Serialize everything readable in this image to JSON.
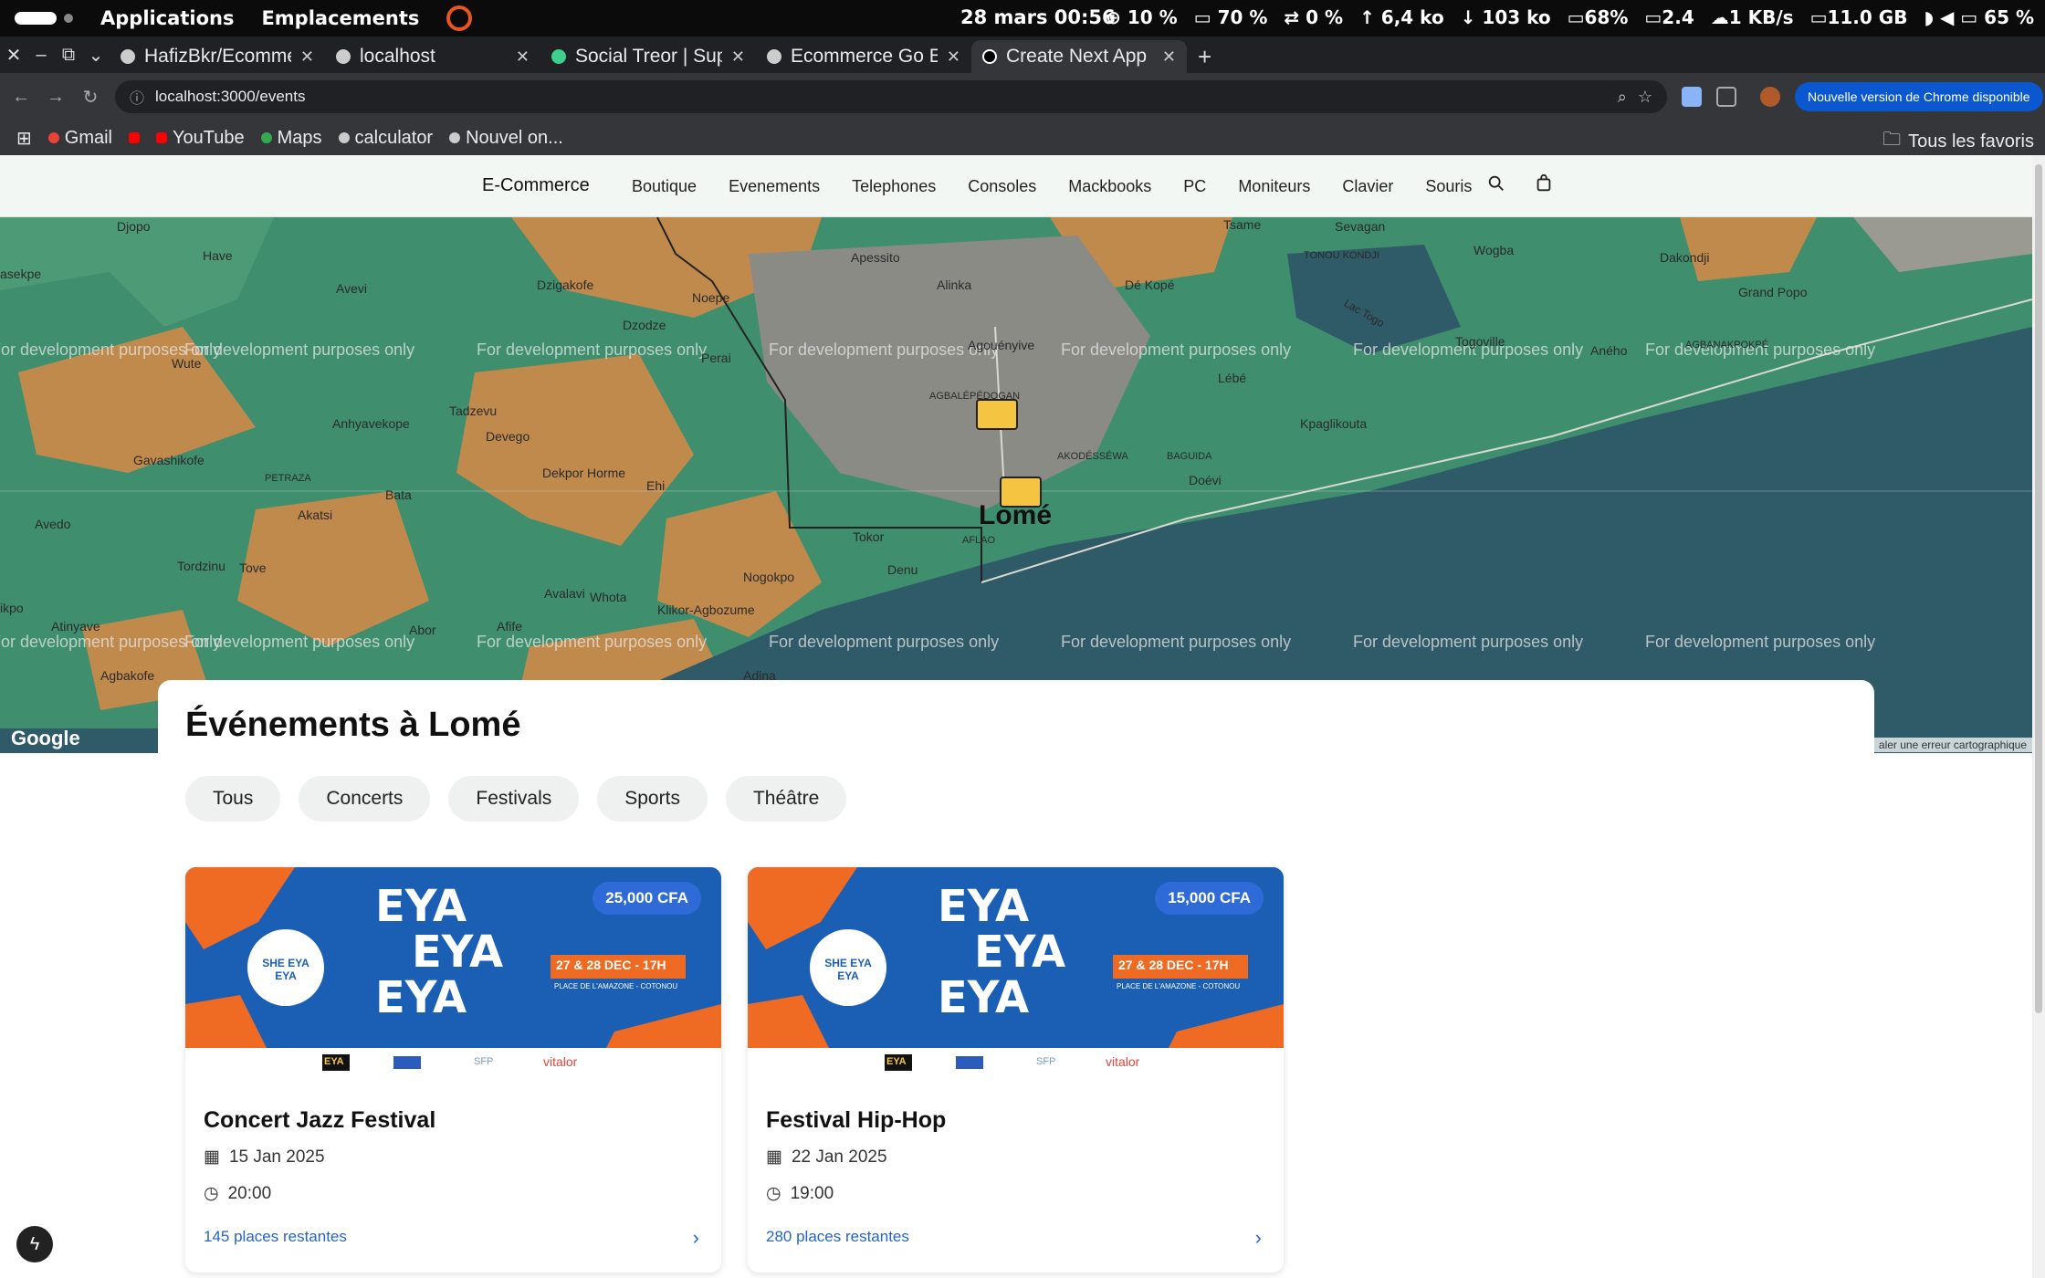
{
  "system": {
    "menu_applications": "Applications",
    "menu_places": "Emplacements",
    "clock": "28 mars  00:56",
    "indicators": [
      "⊕ 10 %",
      "▭ 70 %",
      "⇄ 0 %",
      "↑ 6,4 ko",
      "↓ 103 ko",
      "▭68%",
      "▭2.4",
      "☁1 KB/s",
      "▭11.0 GB",
      "◗ ◀ ▭ 65 %"
    ]
  },
  "browser": {
    "tabs": [
      {
        "title": "HafizBkr/Ecommerce",
        "active": false
      },
      {
        "title": "localhost",
        "active": false
      },
      {
        "title": "Social Treor | Sup",
        "active": false
      },
      {
        "title": "Ecommerce Go E",
        "active": false
      },
      {
        "title": "Create Next App",
        "active": true
      }
    ],
    "url": "localhost:3000/events",
    "update_label": "Nouvelle version de Chrome disponible",
    "bookmarks": [
      "Gmail",
      "YouTube",
      "Maps",
      "calculator",
      "Nouvel on..."
    ],
    "all_bookmarks": "Tous les favoris"
  },
  "site": {
    "brand": "E-Commerce",
    "nav": [
      "Boutique",
      "Evenements",
      "Telephones",
      "Consoles",
      "Mackbooks",
      "PC",
      "Moniteurs",
      "Clavier",
      "Souris"
    ]
  },
  "map": {
    "watermark": "For development purposes only",
    "city": "Lomé",
    "attribution": "Google",
    "error_link": "aler une erreur cartographique",
    "labels": [
      "Djopo",
      "Have",
      "Avevi",
      "Dzigakofe",
      "Dzodze",
      "Apessito",
      "Alinka",
      "Dé Kopé",
      "Tsame",
      "Sevagan",
      "Wogba",
      "Dakondji",
      "TONOU KONDJI",
      "Noepe",
      "Agouényive",
      "Wute",
      "Tadzevu",
      "Anhyavekope",
      "Devego",
      "AGBALÉPÉDOGAN",
      "AKODÉSSÉWA",
      "BAGUIDA",
      "Lébé",
      "Kpaglikouta",
      "Togoville",
      "Aného",
      "Grand Popo",
      "AGBANAKPOKPÉ",
      "Gavashikofe",
      "PETRAZA",
      "Bata",
      "Dekpor Horme",
      "Ehi",
      "Doévi",
      "Avedo",
      "Akatsi",
      "Tordzinu",
      "Tove",
      "Tokor",
      "AFLAO",
      "Denu",
      "Avalavi",
      "Nogokpo",
      "Whota",
      "Klikor-Agbozume",
      "Atinyave",
      "Afife",
      "Abor",
      "Adina",
      "Agbakofe",
      "asekpe",
      "ikpo",
      "Lac Togo",
      "Perai"
    ]
  },
  "events": {
    "title": "Événements à Lomé",
    "filters": [
      "Tous",
      "Concerts",
      "Festivals",
      "Sports",
      "Théâtre"
    ],
    "cards": [
      {
        "name": "Concert Jazz Festival",
        "date": "15 Jan 2025",
        "time": "20:00",
        "price": "25,000 CFA",
        "seats": "145 places restantes"
      },
      {
        "name": "Festival Hip-Hop",
        "date": "22 Jan 2025",
        "time": "19:00",
        "price": "15,000 CFA",
        "seats": "280 places restantes"
      }
    ],
    "poster": {
      "headline": [
        "EYA",
        "EYA",
        "EYA"
      ],
      "badge": "SHE EYA EYA",
      "dates": "27 & 28 DEC - 17H",
      "venue": "PLACE DE L'AMAZONE - COTONOU",
      "sponsors": [
        "EYA",
        "▭",
        "SFP",
        "vitalor"
      ]
    }
  },
  "colors": {
    "map_land": "#3f8f6f",
    "map_water": "#2f5a68",
    "map_urban": "#8b8b86",
    "map_sand": "#c18a4d",
    "accent": "#2563c9"
  }
}
